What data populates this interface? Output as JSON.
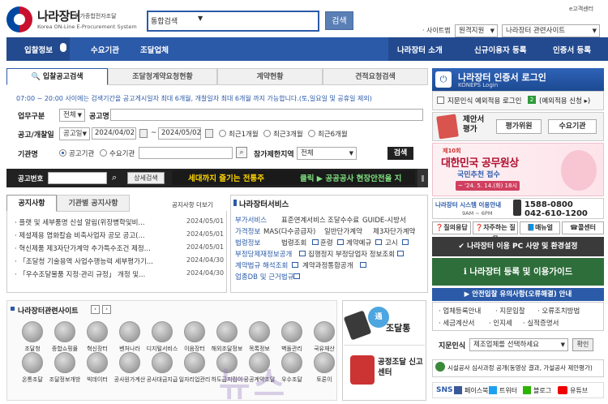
{
  "header": {
    "logo_title": "나라장터",
    "logo_sub_ko": "국가종합전자조달",
    "logo_sub_en": "Korea ON-Line E-Procurement System",
    "search_select": "통합검색",
    "search_button": "검색",
    "top_right": "e고객센터",
    "sitemap_label": "· 사이트맵",
    "remote_support": "원격지원",
    "related_select": "나라장터 관련사이트"
  },
  "nav": {
    "items": [
      "입찰정보",
      "수요기관",
      "조달업체",
      "나라장터 소개",
      "신규이용자 등록",
      "인증서 등록"
    ]
  },
  "search_panel": {
    "tabs": [
      "입찰공고검색",
      "조달청계약요청현황",
      "계약현황",
      "견적요청검색"
    ],
    "notice": "07:00 ~ 20:00 사이에는 검색기간을 공고게시일자 최대 6개월, 개찰일자 최대 6개월 까지 가능합니다.(토,일요일 및 공휴일 제외)",
    "business_label": "업무구분",
    "business_value": "전체",
    "notice_name_label": "공고명",
    "date_label": "공고/개찰일",
    "date_type": "공고일",
    "date_from": "2024/04/02",
    "date_tilde": "~",
    "date_to": "2024/05/02",
    "period_1": "최근1개월",
    "period_3": "최근3개월",
    "period_6": "최근6개월",
    "agency_label": "기관명",
    "agency_opt1": "공고기관",
    "agency_opt2": "수요기관",
    "limit_label": "참가제한지역",
    "limit_value": "전체",
    "search_button": "검색"
  },
  "bid_bar": {
    "label": "공고번호",
    "detail_button": "상세검색",
    "marquee_1": "세대까지 즐기는 전통주",
    "marquee_2": "클릭 ▶ 공공공사 현장안전을 지"
  },
  "notices": {
    "tab_active": "공지사항",
    "tab_other": "기관별 공지사항",
    "more": "공지사항 더보기",
    "items": [
      {
        "title": "· 플랫 및 세부품명 신설 알림(위장병학및비...",
        "date": "2024/05/01"
      },
      {
        "title": "· 제설제용 염화칼슘 비축사업자 공모 공고(...",
        "date": "2024/05/01"
      },
      {
        "title": "· 혁신제품 제3자단가계약 추가특수조건 제정...",
        "date": "2024/05/01"
      },
      {
        "title": "· 「조달청 기술용역 사업수행능력 세부평가기...",
        "date": "2024/04/30"
      },
      {
        "title": "· 「우수조달물품 지정·관리 규정」 개정 및...",
        "date": "2024/04/30"
      }
    ]
  },
  "services": {
    "title": "나라장터서비스",
    "rows": [
      {
        "key": "부가서비스",
        "values": [
          "표준연계서비스",
          "조달수수료",
          "GUIDE-시방서"
        ]
      },
      {
        "key": "가격정보",
        "values": [
          "MAS(다수공급자)",
          "일반단가계약",
          "제3자단가계약"
        ]
      },
      {
        "key": "법령정보",
        "values": [
          "법령조회",
          "훈령",
          "계약예규",
          "고시"
        ]
      },
      {
        "key": "부정당제재정보공개",
        "values": [
          "집행정지 부정당업자 정보조회"
        ]
      },
      {
        "key": "계약법규 해석조회",
        "values": [
          "계약과정통합공개"
        ]
      },
      {
        "key": "업종DB 및 근거법규",
        "values": []
      }
    ]
  },
  "related_sites": {
    "title": "나라장터관련사이트",
    "row1": [
      "조달청",
      "종합쇼핑몰",
      "혁신장터",
      "벤처나라",
      "디지털서비스몰",
      "이음장터",
      "해외조달정보",
      "목록정보",
      "벽돌관리",
      "국유재산"
    ],
    "row2": [
      "온통조달",
      "조달정보개방",
      "빅데이터",
      "공사원가계산",
      "공사대금지급",
      "일자리업관리",
      "하도급지킴이",
      "공공계약조달",
      "우수조달",
      "토론이"
    ]
  },
  "side_banners": {
    "tong_title": "조달통",
    "center_title": "공정조달 신고센터"
  },
  "right": {
    "cert_title": "나라장터 인증서 로그인",
    "cert_sub": "KONEPS Login",
    "cert_option": "지문인식 예외적용 로그인",
    "cert_apply": "(예외적용 신청 ▸)",
    "eval_title": "제안서 평가",
    "eval_btn1": "평가위원",
    "eval_btn2": "수요기관",
    "award_round": "제10회",
    "award_title": "대한민국 공무원상",
    "award_sub": "국민추천 접수",
    "award_date": "~ '24. 5. 14.(화) 18시",
    "callcenter_title": "나라장터 시스템 이용안내",
    "callcenter_hours": "9AM ~ 6PM",
    "phone_1": "1588-0800",
    "phone_2": "042-610-1200",
    "help_buttons": [
      "질의응답",
      "자주하는 질문",
      "매뉴얼",
      "콜센터"
    ],
    "env_button": "나라장터 이용 PC 사양 및 환경설정",
    "guide_button": "나라장터 등록 및 이용가이드",
    "safe_button": "안전입찰 유의사항(오류해결) 안내",
    "links": [
      "업체등록안내",
      "지문입찰",
      "오류조치방법",
      "세금계산서",
      "인지세",
      "실적증명서"
    ],
    "fp_label": "지문인식",
    "fp_select": "제조업체를 선택하세요",
    "fp_confirm": "확인",
    "bottom_notice": "시설공사 심사과정 공개(동영상 결과, 가설공사 제안평가)",
    "sns_label": "SNS",
    "sns_items": [
      "페이스북",
      "트위터",
      "블로그",
      "유튜브"
    ]
  },
  "watermark": "뉴스"
}
